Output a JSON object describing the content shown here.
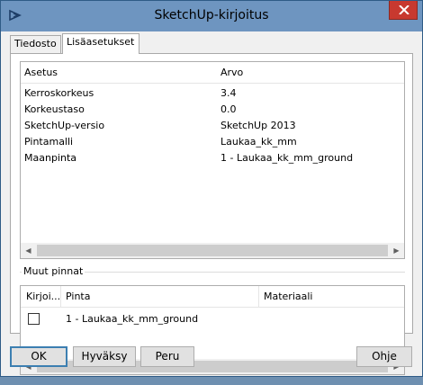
{
  "window": {
    "title": "SketchUp-kirjoitus"
  },
  "icons": {
    "app": "sketchup-app-icon",
    "close": "close-icon",
    "scroll_left": "arrow-left-icon",
    "scroll_right": "arrow-right-icon"
  },
  "tabs": [
    {
      "label": "Tiedosto",
      "active": false
    },
    {
      "label": "Lisäasetukset",
      "active": true
    }
  ],
  "properties": {
    "columns": {
      "setting": "Asetus",
      "value": "Arvo"
    },
    "rows": [
      {
        "setting": "Kerroskorkeus",
        "value": "3.4"
      },
      {
        "setting": "Korkeustaso",
        "value": "0.0"
      },
      {
        "setting": "SketchUp-versio",
        "value": "SketchUp 2013"
      },
      {
        "setting": "Pintamalli",
        "value": "Laukaa_kk_mm"
      },
      {
        "setting": "Maanpinta",
        "value": "1 - Laukaa_kk_mm_ground"
      }
    ]
  },
  "other_surfaces": {
    "title": "Muut pinnat",
    "columns": {
      "write": "Kirjoi...",
      "surface": "Pinta",
      "material": "Materiaali"
    },
    "rows": [
      {
        "checked": false,
        "surface": "1 - Laukaa_kk_mm_ground",
        "material": ""
      }
    ]
  },
  "buttons": {
    "ok": "OK",
    "apply": "Hyväksy",
    "cancel": "Peru",
    "help": "Ohje"
  },
  "colors": {
    "titlebar": "#6e95c0",
    "close_button": "#c8392f",
    "dialog_bg": "#f0f0f0",
    "default_button_border": "#3c7fb1"
  }
}
